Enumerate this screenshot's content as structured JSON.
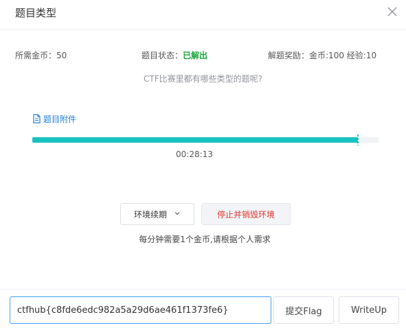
{
  "dialog": {
    "title": "题目类型",
    "close_icon": "close-icon"
  },
  "info": {
    "cost_label": "所需金币：",
    "cost_value": "50",
    "status_label": "题目状态：",
    "status_value": "已解出",
    "reward_label": "解题奖励：",
    "reward_value": "金币:100 经验:10"
  },
  "question": "CTF比赛里都有哪些类型的题呢?",
  "attachment": {
    "label": "题目附件",
    "icon": "file-icon"
  },
  "progress": {
    "fraction": 0.94,
    "timer": "00:28:13"
  },
  "environment": {
    "renew_label": "环境续期",
    "renew_icon": "chevron-down-icon",
    "destroy_label": "停止并销毁环境",
    "hint": "每分钟需要1个金币,请根据个人需求"
  },
  "flag": {
    "value": "ctfhub{c8fde6edc982a5a29d6ae461f1373fe6}",
    "submit_label": "提交Flag",
    "writeup_label": "WriteUp"
  },
  "colors": {
    "accent": "#19c2c1",
    "solved": "#19a83a",
    "danger": "#e0382f",
    "link": "#1f7fdc",
    "focus": "#409eff"
  }
}
